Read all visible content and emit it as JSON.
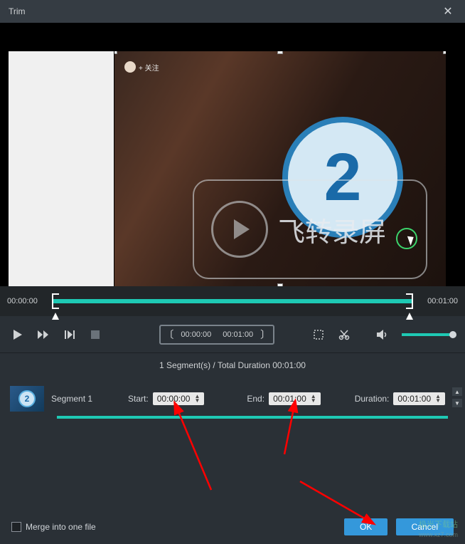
{
  "window": {
    "title": "Trim"
  },
  "badge": {
    "follow": "+ 关注"
  },
  "countdown": {
    "number": "2"
  },
  "overlay": {
    "label": "飞转录屏"
  },
  "timeline": {
    "start": "00:00:00",
    "end": "00:01:00"
  },
  "range": {
    "start": "00:00:00",
    "end": "00:01:00"
  },
  "summary": "1 Segment(s) / Total Duration 00:01:00",
  "segment": {
    "name": "Segment 1",
    "start_label": "Start:",
    "start_value": "00:00:00",
    "end_label": "End:",
    "end_value": "00:01:00",
    "duration_label": "Duration:",
    "duration_value": "00:01:00",
    "thumb_num": "2"
  },
  "merge": {
    "label": "Merge into one file"
  },
  "buttons": {
    "ok": "OK",
    "cancel": "Cancel"
  },
  "watermark": {
    "line1": "极光下载站",
    "line2": "www.xz7.com"
  }
}
